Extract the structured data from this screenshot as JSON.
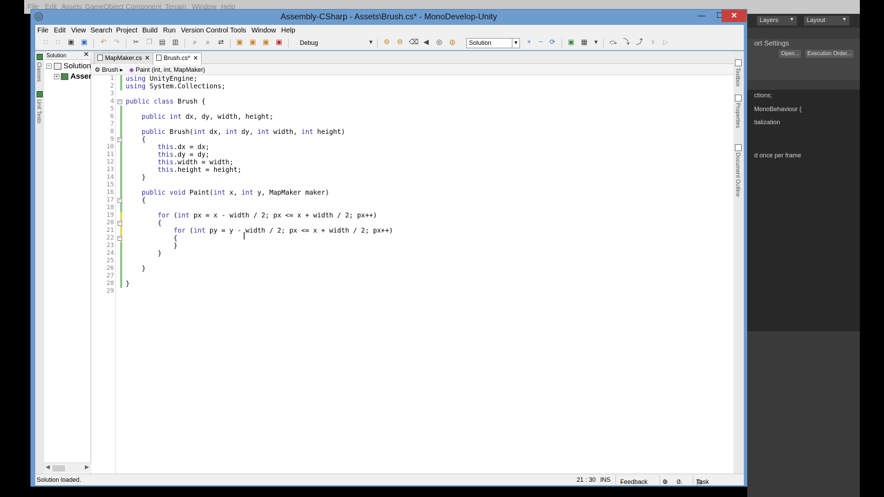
{
  "unity": {
    "menu": [
      "File",
      "Edit",
      "Assets",
      "GameObject",
      "Component",
      "Terrain",
      "Window",
      "Help"
    ],
    "layers_dropdown": "Layers",
    "layout_dropdown": "Layout",
    "panel_title": "ort Settings",
    "open_button": "Open...",
    "exec_button": "Execution Order...",
    "preview": [
      "ctions;",
      "MonoBehaviour {",
      "tialization",
      "d once per frame"
    ]
  },
  "window": {
    "title": "Assembly-CSharp - Assets\\Brush.cs* - MonoDevelop-Unity",
    "min": "—",
    "max": "☐",
    "close": "✕"
  },
  "menubar": [
    "File",
    "Edit",
    "View",
    "Search",
    "Project",
    "Build",
    "Run",
    "Version Control",
    "Tools",
    "Window",
    "Help"
  ],
  "toolbar": {
    "config": "Debug",
    "scope": "Solution"
  },
  "left_pads": [
    "Classes",
    "Unit Tests"
  ],
  "solution_pad": {
    "title": "Solution",
    "close": "✕",
    "root": "Solution",
    "child": "Assembly-CSharp"
  },
  "tabs": [
    {
      "label": "MapMaker.cs",
      "close": "✕"
    },
    {
      "label": "Brush.cs*",
      "close": "✕"
    }
  ],
  "breadcrumb": {
    "class": "Brush",
    "method": "Paint (int, int, MapMaker)"
  },
  "code_lines": [
    "using UnityEngine;",
    "using System.Collections;",
    "",
    "public class Brush {",
    "",
    "    public int dx, dy, width, height;",
    "",
    "    public Brush(int dx, int dy, int width, int height)",
    "    {",
    "        this.dx = dx;",
    "        this.dy = dy;",
    "        this.width = width;",
    "        this.height = height;",
    "    }",
    "",
    "    public void Paint(int x, int y, MapMaker maker)",
    "    {",
    "",
    "        for (int px = x - width / 2; px <= x + width / 2; px++)",
    "        {",
    "            for (int py = y - width / 2; px <= x + width / 2; px++)",
    "            {",
    "            }",
    "        }",
    "",
    "    }",
    "",
    "}",
    ""
  ],
  "right_pads": [
    "Toolbox",
    "Properties",
    "Document Outline"
  ],
  "status": {
    "message": "Solution loaded.",
    "position": "21 : 30",
    "mode": "INS",
    "feedback": "Feedback",
    "errors": "0",
    "warnings": "0",
    "tasks": "Task List"
  }
}
